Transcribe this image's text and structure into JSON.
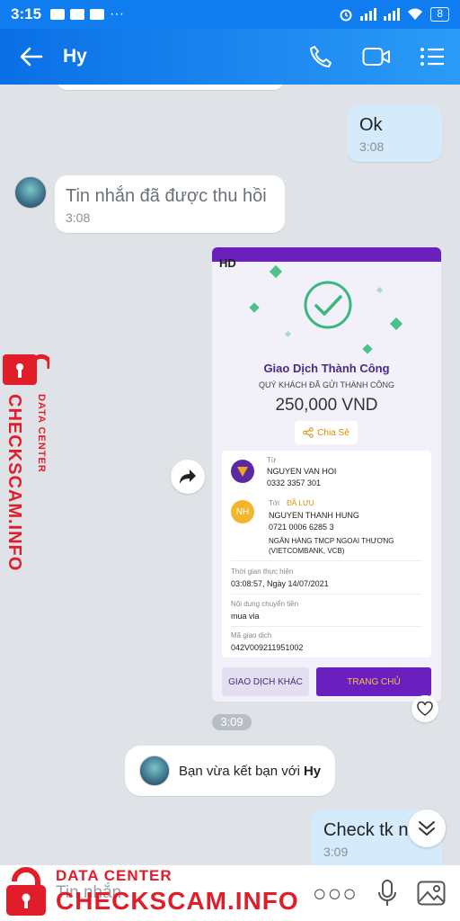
{
  "status_bar": {
    "time": "3:15",
    "battery": "8"
  },
  "header": {
    "contact_name": "Hy"
  },
  "messages": {
    "m1": {
      "text": "Ok",
      "time": "3:08"
    },
    "m2": {
      "text": "Tin nhắn đã được thu hồi",
      "time": "3:08"
    },
    "image_time": "3:09",
    "friend_notice_prefix": "Bạn vừa kết bạn với",
    "friend_notice_name": "Hy",
    "m4": {
      "text": "Check tk n",
      "time": "3:09"
    }
  },
  "receipt": {
    "hd_badge": "HD",
    "title": "Giao Dịch Thành Công",
    "subtitle": "QUÝ KHÁCH ĐÃ GỬI THÀNH CÔNG",
    "amount": "250,000 VND",
    "share_label": "Chia Sẻ",
    "from_label": "Từ",
    "from_name": "NGUYEN VAN HOI",
    "from_account": "0332 3357 301",
    "to_label": "Tới",
    "to_saved": "ĐÃ LƯU",
    "to_initials": "NH",
    "to_name": "NGUYEN THANH HUNG",
    "to_account": "0721 0006 6285 3",
    "to_bank": "NGÂN HÀNG TMCP NGOAI THƯƠNG (VIETCOMBANK, VCB)",
    "time_label": "Thời gian thực hiện",
    "time_value": "03:08:57, Ngày 14/07/2021",
    "content_label": "Nội dung chuyển tiền",
    "content_value": "mua via",
    "code_label": "Mã giao dịch",
    "code_value": "042V009211951002",
    "btn_other": "GIAO DỊCH KHÁC",
    "btn_home": "TRANG CHỦ"
  },
  "input": {
    "placeholder": "Tin nhắn"
  },
  "watermark": {
    "line1": "DATA CENTER",
    "line2": "CHECKSCAM.INFO"
  },
  "colors": {
    "brand_blue": "#0f7df0",
    "my_bubble": "#d5ebfb",
    "watermark_red": "#e11d2a",
    "receipt_purple": "#6a1fbf"
  }
}
